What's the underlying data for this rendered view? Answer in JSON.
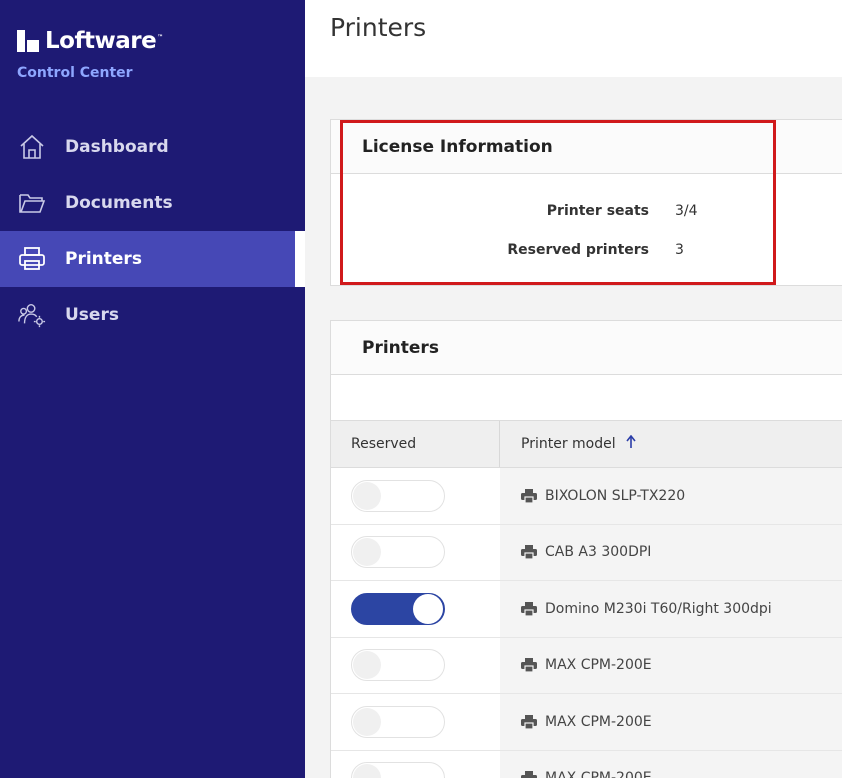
{
  "brand": {
    "name": "Loftware",
    "tm": "™",
    "subtitle": "Control Center"
  },
  "nav": [
    {
      "label": "Dashboard",
      "icon": "home-icon",
      "active": false
    },
    {
      "label": "Documents",
      "icon": "folder-icon",
      "active": false
    },
    {
      "label": "Printers",
      "icon": "printer-icon",
      "active": true
    },
    {
      "label": "Users",
      "icon": "users-gear-icon",
      "active": false
    }
  ],
  "page": {
    "title": "Printers"
  },
  "license": {
    "title": "License Information",
    "printer_seats_label": "Printer seats",
    "printer_seats_value": "3/4",
    "reserved_label": "Reserved printers",
    "reserved_value": "3"
  },
  "printers": {
    "title": "Printers",
    "columns": {
      "reserved": "Reserved",
      "model": "Printer model",
      "sort_icon": "arrow-up-icon"
    },
    "rows": [
      {
        "reserved": false,
        "model": "BIXOLON SLP-TX220"
      },
      {
        "reserved": false,
        "model": "CAB A3 300DPI"
      },
      {
        "reserved": true,
        "model": "Domino M230i T60/Right 300dpi"
      },
      {
        "reserved": false,
        "model": "MAX CPM-200E"
      },
      {
        "reserved": false,
        "model": "MAX CPM-200E"
      },
      {
        "reserved": false,
        "model": "MAX CPM-200E"
      }
    ]
  },
  "colors": {
    "sidebar": "#1e1a74",
    "active_nav": "#4648b6",
    "accent": "#2c45a3",
    "highlight": "#d0191b"
  }
}
